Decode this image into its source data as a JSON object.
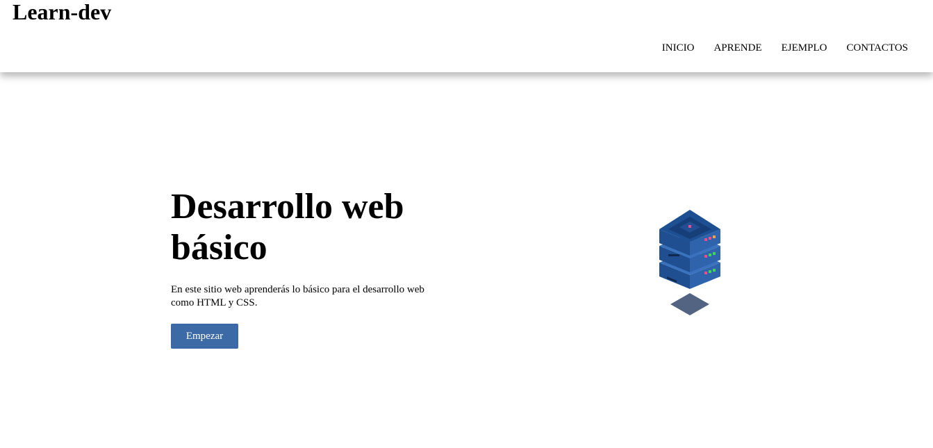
{
  "header": {
    "logo": "Learn-dev",
    "nav": [
      {
        "label": "INICIO"
      },
      {
        "label": "APRENDE"
      },
      {
        "label": "EJEMPLO"
      },
      {
        "label": "CONTACTOS"
      }
    ]
  },
  "hero": {
    "title_line1": "Desarrollo web",
    "title_line2": "básico",
    "description": "En este sitio web aprenderás lo básico para el desarrollo web como HTML y CSS.",
    "button_label": "Empezar",
    "button_color": "#3c6aa6",
    "illustration_icon": "server-stack-icon"
  }
}
